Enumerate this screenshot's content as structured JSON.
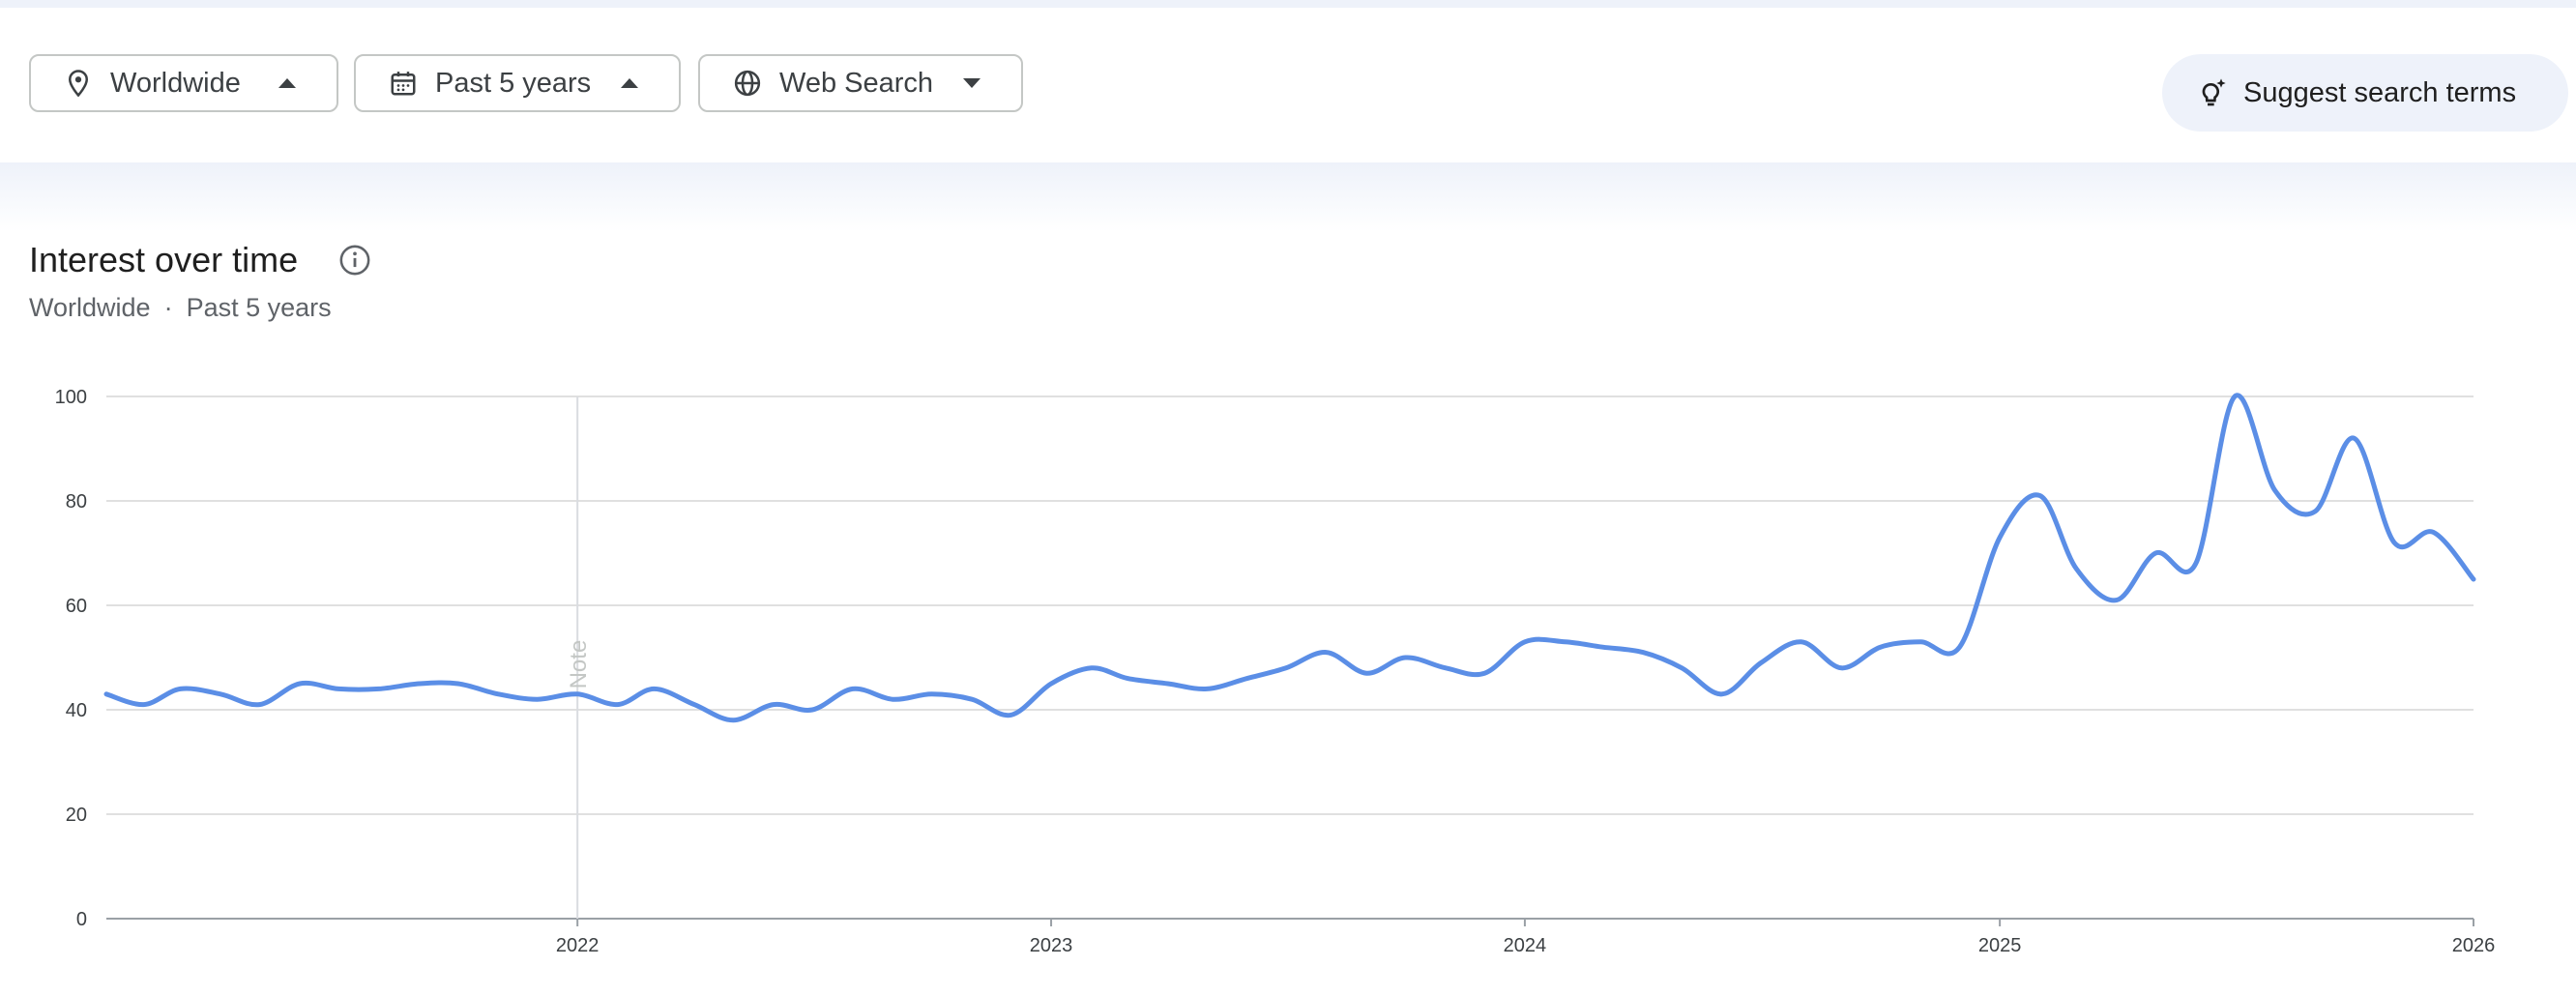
{
  "filters": {
    "location": {
      "label": "Worldwide",
      "icon": "location-pin-icon"
    },
    "time": {
      "label": "Past 5 years",
      "icon": "calendar-icon"
    },
    "property": {
      "label": "Web Search",
      "icon": "globe-icon"
    }
  },
  "suggest": {
    "label": "Suggest search terms",
    "icon": "lightbulb-sparkle-icon"
  },
  "card": {
    "title": "Interest over time",
    "subtitle_location": "Worldwide",
    "subtitle_separator": "·",
    "subtitle_time": "Past 5 years"
  },
  "colors": {
    "line": "#5b8ee6",
    "grid": "#e0e0e0",
    "axis": "#9aa0a6",
    "chip_bg": "#eef2fa"
  },
  "chart_data": {
    "type": "line",
    "title": "",
    "xlabel": "",
    "ylabel": "",
    "ylim": [
      0,
      100
    ],
    "yticks": [
      0,
      20,
      40,
      60,
      80,
      100
    ],
    "xlim": [
      "2021-01-03",
      "2026-01-01"
    ],
    "xticks": [
      "2022",
      "2023",
      "2024",
      "2025",
      "2026"
    ],
    "grid": true,
    "legend": "none",
    "annotation": {
      "label": "Note",
      "x": "2022-01-01"
    },
    "series": [
      {
        "points": [
          [
            "2021-01-03",
            43
          ],
          [
            "2021-02-01",
            41
          ],
          [
            "2021-03-01",
            44
          ],
          [
            "2021-04-01",
            43
          ],
          [
            "2021-05-01",
            41
          ],
          [
            "2021-06-01",
            45
          ],
          [
            "2021-07-01",
            44
          ],
          [
            "2021-08-01",
            44
          ],
          [
            "2021-09-01",
            45
          ],
          [
            "2021-10-01",
            45
          ],
          [
            "2021-11-01",
            43
          ],
          [
            "2021-12-01",
            42
          ],
          [
            "2022-01-01",
            43
          ],
          [
            "2022-02-01",
            41
          ],
          [
            "2022-03-01",
            44
          ],
          [
            "2022-04-01",
            41
          ],
          [
            "2022-05-01",
            38
          ],
          [
            "2022-06-01",
            41
          ],
          [
            "2022-07-01",
            40
          ],
          [
            "2022-08-01",
            44
          ],
          [
            "2022-09-01",
            42
          ],
          [
            "2022-10-01",
            43
          ],
          [
            "2022-11-01",
            42
          ],
          [
            "2022-12-01",
            39
          ],
          [
            "2023-01-01",
            45
          ],
          [
            "2023-02-01",
            48
          ],
          [
            "2023-03-01",
            46
          ],
          [
            "2023-04-01",
            45
          ],
          [
            "2023-05-01",
            44
          ],
          [
            "2023-06-01",
            46
          ],
          [
            "2023-07-01",
            48
          ],
          [
            "2023-08-01",
            51
          ],
          [
            "2023-09-01",
            47
          ],
          [
            "2023-10-01",
            50
          ],
          [
            "2023-11-01",
            48
          ],
          [
            "2023-12-01",
            47
          ],
          [
            "2024-01-01",
            53
          ],
          [
            "2024-02-01",
            53
          ],
          [
            "2024-03-01",
            52
          ],
          [
            "2024-04-01",
            51
          ],
          [
            "2024-05-01",
            48
          ],
          [
            "2024-06-01",
            43
          ],
          [
            "2024-07-01",
            49
          ],
          [
            "2024-08-01",
            53
          ],
          [
            "2024-09-01",
            48
          ],
          [
            "2024-10-01",
            52
          ],
          [
            "2024-11-01",
            53
          ],
          [
            "2024-12-01",
            52
          ],
          [
            "2025-01-01",
            73
          ],
          [
            "2025-02-01",
            81
          ],
          [
            "2025-03-01",
            67
          ],
          [
            "2025-04-01",
            61
          ],
          [
            "2025-05-01",
            70
          ],
          [
            "2025-06-01",
            68
          ],
          [
            "2025-07-01",
            100
          ],
          [
            "2025-08-01",
            82
          ],
          [
            "2025-09-01",
            78
          ],
          [
            "2025-10-01",
            92
          ],
          [
            "2025-11-01",
            72
          ],
          [
            "2025-12-01",
            74
          ],
          [
            "2026-01-01",
            65
          ]
        ]
      }
    ]
  }
}
